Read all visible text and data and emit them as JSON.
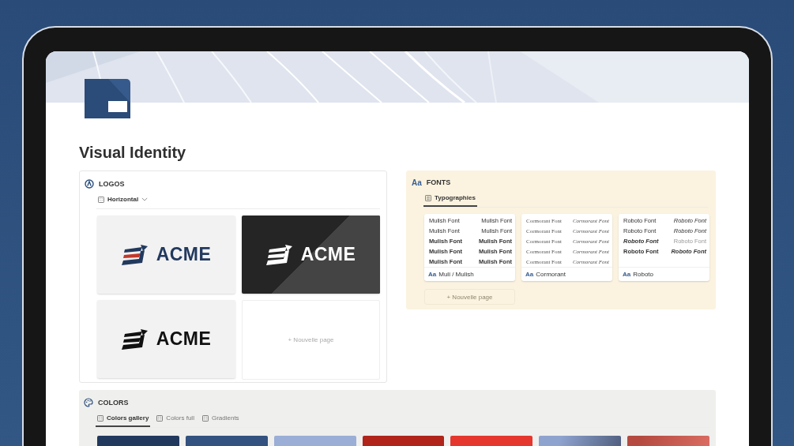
{
  "page": {
    "title": "Visual Identity"
  },
  "logos": {
    "title": "LOGOS",
    "view": {
      "label": "Horizontal",
      "selected": true
    },
    "cards": [
      {
        "kind": "color",
        "wordmark": "ACME"
      },
      {
        "kind": "inverse",
        "wordmark": "ACME"
      },
      {
        "kind": "mono",
        "wordmark": "ACME"
      },
      {
        "kind": "new",
        "label": "+ Nouvelle page"
      }
    ]
  },
  "fonts": {
    "icon_text": "Aa",
    "title": "FONTS",
    "view": {
      "label": "Typographies",
      "selected": true
    },
    "cards": [
      {
        "kind": "sans",
        "name": "Muli / Mulish",
        "icon_text": "Aa",
        "rows": [
          [
            {
              "text": "Mulish Font",
              "kind": "regular"
            },
            {
              "text": "Mulish Font",
              "kind": "regular"
            }
          ],
          [
            {
              "text": "Mulish Font",
              "kind": "medium"
            },
            {
              "text": "Mulish Font",
              "kind": "medium"
            }
          ],
          [
            {
              "text": "Mulish Font",
              "kind": "semibold"
            },
            {
              "text": "Mulish Font",
              "kind": "semibold"
            }
          ],
          [
            {
              "text": "Mulish Font",
              "kind": "bold"
            },
            {
              "text": "Mulish Font",
              "kind": "bold"
            }
          ],
          [
            {
              "text": "Mulish Font",
              "kind": "black"
            },
            {
              "text": "Mulish Font",
              "kind": "black"
            }
          ]
        ]
      },
      {
        "kind": "serif",
        "name": "Cormorant",
        "icon_text": "Aa",
        "rows": [
          [
            {
              "text": "Cormorant Font",
              "kind": "regular"
            },
            {
              "text": "Cormorant Font",
              "kind": "italic"
            }
          ],
          [
            {
              "text": "Cormorant Font",
              "kind": "regular"
            },
            {
              "text": "Cormorant Font",
              "kind": "italic"
            }
          ],
          [
            {
              "text": "Cormorant Font",
              "kind": "regular"
            },
            {
              "text": "Cormorant Font",
              "kind": "italic"
            }
          ],
          [
            {
              "text": "Cormorant Font",
              "kind": "regular"
            },
            {
              "text": "Cormorant Font",
              "kind": "italic"
            }
          ],
          [
            {
              "text": "Cormorant Font",
              "kind": "regular"
            },
            {
              "text": "Cormorant Font",
              "kind": "italic"
            }
          ]
        ]
      },
      {
        "kind": "sans",
        "name": "Roboto",
        "icon_text": "Aa",
        "rows": [
          [
            {
              "text": "Roboto Font",
              "kind": "regular"
            },
            {
              "text": "Roboto Font",
              "kind": "italic"
            }
          ],
          [
            {
              "text": "Roboto Font",
              "kind": "medium"
            },
            {
              "text": "Roboto Font",
              "kind": "mediumitalic"
            }
          ],
          [
            {
              "text": "Roboto Font",
              "kind": "bolditalic"
            },
            {
              "text": "Roboto Font",
              "kind": "light"
            }
          ],
          [
            {
              "text": "Roboto Font",
              "kind": "bold"
            },
            {
              "text": "Roboto Font",
              "kind": "bolditalic"
            }
          ]
        ]
      }
    ],
    "new_page": {
      "label": "+ Nouvelle page",
      "disabled": true
    }
  },
  "colors": {
    "title": "COLORS",
    "tabs": [
      {
        "label": "Colors gallery",
        "selected": true
      },
      {
        "label": "Colors full",
        "selected": false
      },
      {
        "label": "Gradients",
        "selected": false
      }
    ],
    "swatches": [
      {
        "kind": "solid",
        "color": "#22395e"
      },
      {
        "kind": "solid",
        "color": "#33527f"
      },
      {
        "kind": "solid",
        "color": "#9aaed6"
      },
      {
        "kind": "solid",
        "color": "#b0241a"
      },
      {
        "kind": "solid",
        "color": "#e5372e"
      },
      {
        "kind": "darkening",
        "color": "#8fa3cf"
      },
      {
        "kind": "lightening",
        "color": "#b44a40"
      }
    ]
  }
}
